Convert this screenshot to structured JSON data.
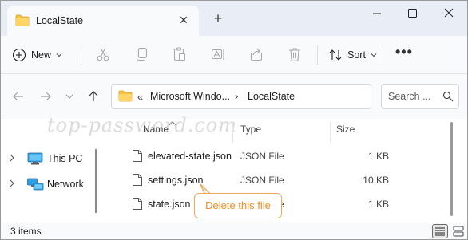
{
  "window": {
    "tab_title": "LocalState",
    "tab_close": "✕",
    "new_tab": "+",
    "accent": "#0067c0",
    "folder_color": "#f5c243"
  },
  "command_bar": {
    "new_label": "New",
    "sort_label": "Sort",
    "more_label": "•••",
    "icons": [
      "new-icon",
      "cut-icon",
      "copy-icon",
      "paste-icon",
      "rename-icon",
      "share-icon",
      "delete-icon",
      "sort-icon"
    ]
  },
  "address_bar": {
    "overflow": "«",
    "crumbs": [
      "Microsoft.Windo...",
      "LocalState"
    ],
    "separator": "›"
  },
  "search": {
    "placeholder": "Search ..."
  },
  "watermark": "top-password.com",
  "navigation_pane": {
    "items": [
      {
        "label": "This PC",
        "icon": "this-pc-icon"
      },
      {
        "label": "Network",
        "icon": "network-icon"
      }
    ]
  },
  "columns": {
    "name": "Name",
    "type": "Type",
    "size": "Size"
  },
  "files": [
    {
      "name": "elevated-state.json",
      "type": "JSON File",
      "size": "1 KB"
    },
    {
      "name": "settings.json",
      "type": "JSON File",
      "size": "10 KB"
    },
    {
      "name": "state.json",
      "type": "JSON File",
      "size": "1 KB"
    }
  ],
  "callout": {
    "text": "Delete this file",
    "color": "#f08c2a"
  },
  "status_bar": {
    "item_count": "3 items"
  }
}
